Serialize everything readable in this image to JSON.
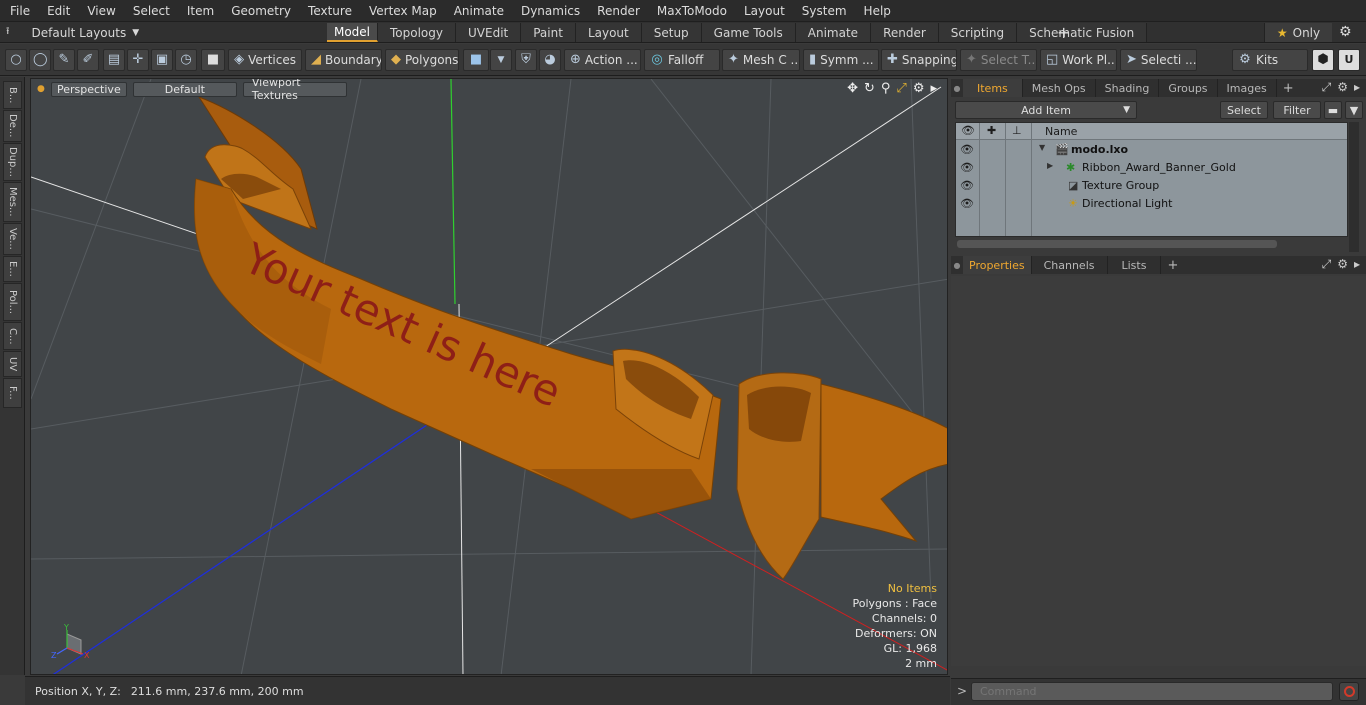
{
  "menu": [
    "File",
    "Edit",
    "View",
    "Select",
    "Item",
    "Geometry",
    "Texture",
    "Vertex Map",
    "Animate",
    "Dynamics",
    "Render",
    "MaxToModo",
    "Layout",
    "System",
    "Help"
  ],
  "layout": {
    "selector": "Default Layouts",
    "tabs": [
      "Model",
      "Topology",
      "UVEdit",
      "Paint",
      "Layout",
      "Setup",
      "Game Tools",
      "Animate",
      "Render",
      "Scripting",
      "Schematic Fusion"
    ],
    "active_tab": "Model",
    "only_label": "Only"
  },
  "toolbar": {
    "vertices": "Vertices",
    "boundary": "Boundary",
    "polygons": "Polygons",
    "action": "Action ...",
    "falloff": "Falloff",
    "mesh": "Mesh C ...",
    "symm": "Symm ...",
    "snapping": "Snapping",
    "select_t": "Select T...",
    "work_plane": "Work Pl...",
    "selection": "Selecti ...",
    "kits": "Kits"
  },
  "left_tabs": [
    "B...",
    "De...",
    "Dup...",
    "Mes...",
    "Ve...",
    "E...",
    "Pol...",
    "C...",
    "UV",
    "F..."
  ],
  "viewport": {
    "view": "Perspective",
    "shading": "Default",
    "textures": "Viewport Textures",
    "banner_text": "Your text is here",
    "info": {
      "selection": "No Items",
      "polygons": "Polygons : Face",
      "channels": "Channels: 0",
      "deformers": "Deformers: ON",
      "gl": "GL: 1,968",
      "unit": "2 mm"
    },
    "axis_labels": {
      "x": "X",
      "y": "Y",
      "z": "Z"
    }
  },
  "status": {
    "label": "Position X, Y, Z:",
    "value": "211.6 mm, 237.6 mm, 200 mm"
  },
  "items_panel": {
    "tabs": [
      "Items",
      "Mesh Ops",
      "Shading",
      "Groups",
      "Images"
    ],
    "active_tab": "Items",
    "add_item": "Add Item",
    "select": "Select",
    "filter": "Filter",
    "column_name": "Name",
    "rows": [
      {
        "name": "modo.lxo",
        "icon": "scene-icon"
      },
      {
        "name": "Ribbon_Award_Banner_Gold",
        "icon": "mesh-icon"
      },
      {
        "name": "Texture Group",
        "icon": "texture-group-icon"
      },
      {
        "name": "Directional Light",
        "icon": "light-icon"
      }
    ]
  },
  "properties_panel": {
    "tabs": [
      "Properties",
      "Channels",
      "Lists"
    ],
    "active_tab": "Properties"
  },
  "command": {
    "placeholder": "Command"
  },
  "colors": {
    "accent": "#e0a030",
    "banner": "#b86a10",
    "banner_text": "#8a1818",
    "viewport_bg": "#414548",
    "tree_bg": "#8d969c"
  }
}
